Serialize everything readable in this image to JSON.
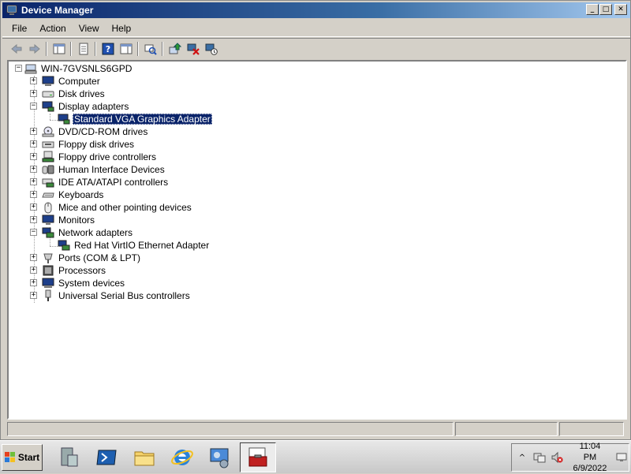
{
  "window": {
    "title": "Device Manager"
  },
  "menu": [
    "File",
    "Action",
    "View",
    "Help"
  ],
  "tree": {
    "root": "WIN-7GVSNLS6GPD",
    "nodes": [
      {
        "label": "Computer",
        "icon": "computer-icon"
      },
      {
        "label": "Disk drives",
        "icon": "disk-drive-icon"
      },
      {
        "label": "Display adapters",
        "icon": "display-adapter-icon"
      },
      {
        "label": "Standard VGA Graphics Adapter",
        "icon": "display-adapter-icon"
      },
      {
        "label": "DVD/CD-ROM drives",
        "icon": "dvd-drive-icon"
      },
      {
        "label": "Floppy disk drives",
        "icon": "floppy-drive-icon"
      },
      {
        "label": "Floppy drive controllers",
        "icon": "floppy-controller-icon"
      },
      {
        "label": "Human Interface Devices",
        "icon": "hid-icon"
      },
      {
        "label": "IDE ATA/ATAPI controllers",
        "icon": "ide-controller-icon"
      },
      {
        "label": "Keyboards",
        "icon": "keyboard-icon"
      },
      {
        "label": "Mice and other pointing devices",
        "icon": "mouse-icon"
      },
      {
        "label": "Monitors",
        "icon": "monitor-icon"
      },
      {
        "label": "Network adapters",
        "icon": "network-adapter-icon"
      },
      {
        "label": "Red Hat VirtIO Ethernet Adapter",
        "icon": "network-adapter-icon"
      },
      {
        "label": "Ports (COM & LPT)",
        "icon": "port-icon"
      },
      {
        "label": "Processors",
        "icon": "processor-icon"
      },
      {
        "label": "System devices",
        "icon": "system-device-icon"
      },
      {
        "label": "Universal Serial Bus controllers",
        "icon": "usb-icon"
      }
    ]
  },
  "taskbar": {
    "start_label": "Start",
    "clock_time": "11:04 PM",
    "clock_date": "6/9/2022"
  }
}
